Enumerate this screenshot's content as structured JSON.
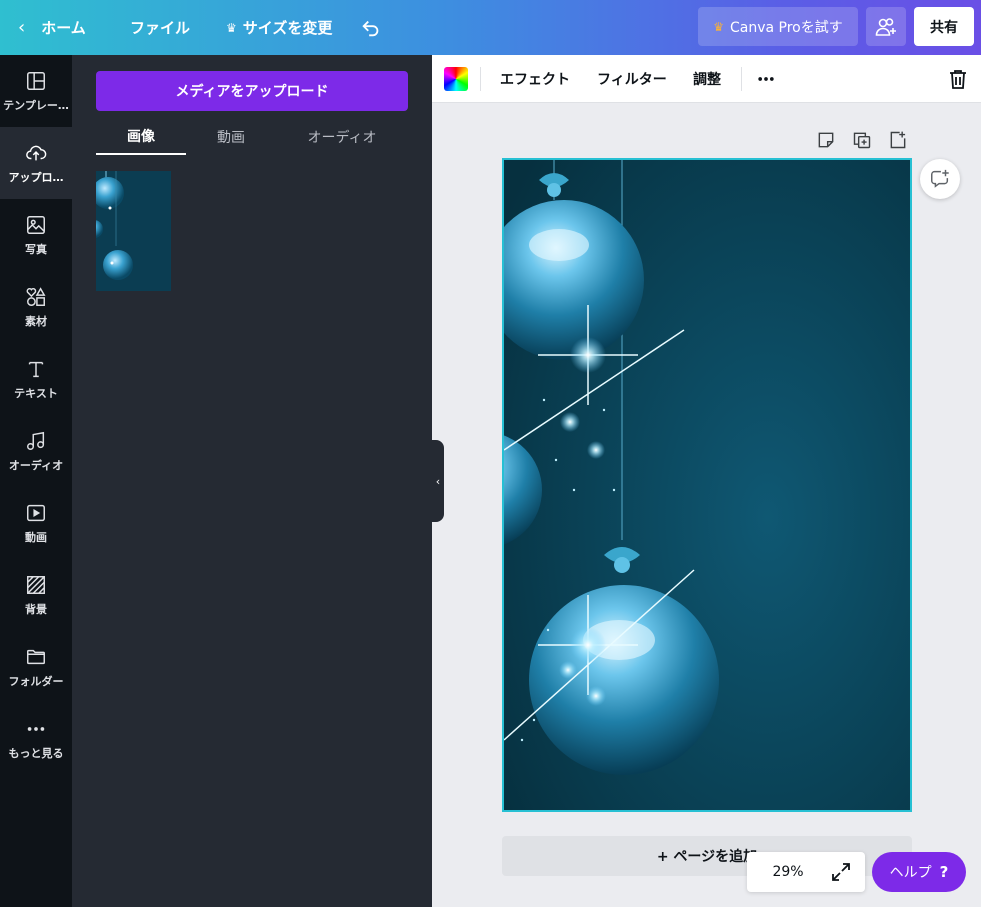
{
  "topbar": {
    "home_label": "ホーム",
    "file_label": "ファイル",
    "resize_label": "サイズを変更",
    "pro_label": "Canva Proを試す",
    "share_label": "共有"
  },
  "rail": {
    "items": [
      {
        "label": "テンプレー…",
        "icon": "template-icon"
      },
      {
        "label": "アップロ…",
        "icon": "upload-icon"
      },
      {
        "label": "写真",
        "icon": "photo-icon"
      },
      {
        "label": "素材",
        "icon": "elements-icon"
      },
      {
        "label": "テキスト",
        "icon": "text-icon"
      },
      {
        "label": "オーディオ",
        "icon": "audio-icon"
      },
      {
        "label": "動画",
        "icon": "video-icon"
      },
      {
        "label": "背景",
        "icon": "background-icon"
      },
      {
        "label": "フォルダー",
        "icon": "folder-icon"
      },
      {
        "label": "もっと見る",
        "icon": "more-icon"
      }
    ],
    "active_index": 1
  },
  "panel": {
    "upload_button": "メディアをアップロード",
    "tabs": [
      "画像",
      "動画",
      "オーディオ"
    ],
    "active_tab": 0
  },
  "editor_toolbar": {
    "effect": "エフェクト",
    "filter": "フィルター",
    "adjust": "調整"
  },
  "canvas": {
    "add_page": "+ ページを追加",
    "zoom": "29%"
  },
  "help": {
    "label": "ヘルプ",
    "icon_glyph": "?"
  },
  "colors": {
    "accent": "#7d2ae8",
    "selection": "#27c0d3",
    "rail_bg": "#0e1318",
    "panel_bg": "#252a33"
  }
}
